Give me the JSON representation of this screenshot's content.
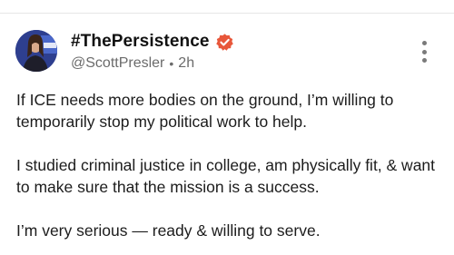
{
  "post": {
    "display_name": "#ThePersistence",
    "handle": "@ScottPresler",
    "separator": "•",
    "time_ago": "2h",
    "paragraphs": [
      "If ICE needs more bodies on the ground, I’m willing to temporarily stop my political work to help.",
      "I studied criminal justice in college, am physically fit, & want to make sure that the mission is a success.",
      "I’m very serious — ready & willing to serve."
    ]
  },
  "icons": {
    "verified": "verified-badge-icon",
    "more": "more-vertical-icon"
  },
  "colors": {
    "verified_badge": "#e8573a",
    "secondary_text": "#6b6b6b",
    "avatar_background": "#2e3f8f"
  }
}
